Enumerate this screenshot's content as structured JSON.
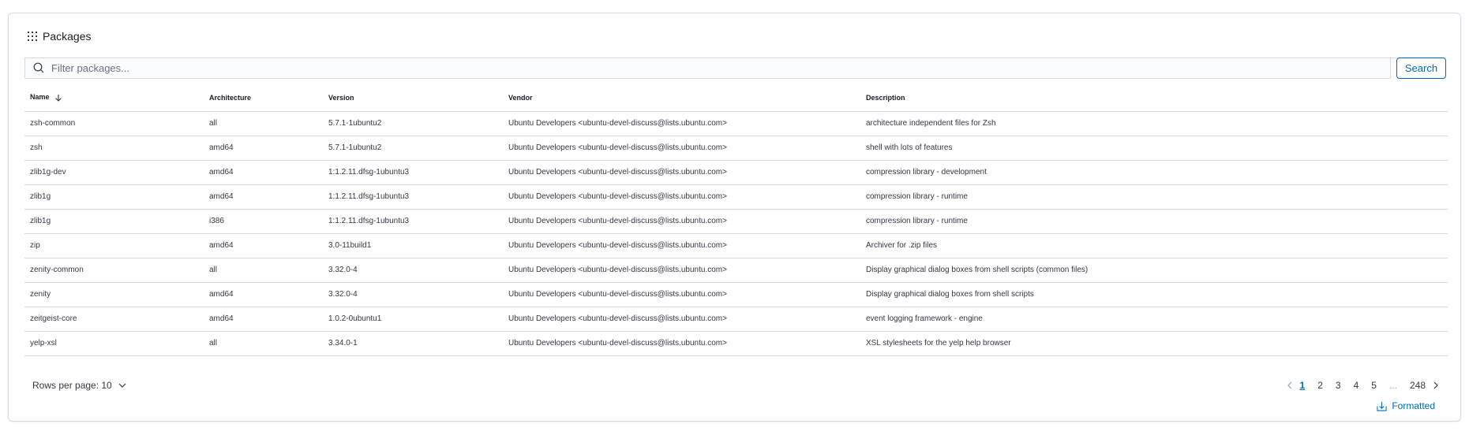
{
  "panel": {
    "title": "Packages"
  },
  "search": {
    "placeholder": "Filter packages...",
    "value": "",
    "button_label": "Search"
  },
  "table": {
    "columns": [
      "Name",
      "Architecture",
      "Version",
      "Vendor",
      "Description"
    ],
    "sorted_column": "Name",
    "sort_direction": "descending",
    "rows": [
      [
        "zsh-common",
        "all",
        "5.7.1-1ubuntu2",
        "Ubuntu Developers <ubuntu-devel-discuss@lists.ubuntu.com>",
        "architecture independent files for Zsh"
      ],
      [
        "zsh",
        "amd64",
        "5.7.1-1ubuntu2",
        "Ubuntu Developers <ubuntu-devel-discuss@lists.ubuntu.com>",
        "shell with lots of features"
      ],
      [
        "zlib1g-dev",
        "amd64",
        "1:1.2.11.dfsg-1ubuntu3",
        "Ubuntu Developers <ubuntu-devel-discuss@lists.ubuntu.com>",
        "compression library - development"
      ],
      [
        "zlib1g",
        "amd64",
        "1:1.2.11.dfsg-1ubuntu3",
        "Ubuntu Developers <ubuntu-devel-discuss@lists.ubuntu.com>",
        "compression library - runtime"
      ],
      [
        "zlib1g",
        "i386",
        "1:1.2.11.dfsg-1ubuntu3",
        "Ubuntu Developers <ubuntu-devel-discuss@lists.ubuntu.com>",
        "compression library - runtime"
      ],
      [
        "zip",
        "amd64",
        "3.0-11build1",
        "Ubuntu Developers <ubuntu-devel-discuss@lists.ubuntu.com>",
        "Archiver for .zip files"
      ],
      [
        "zenity-common",
        "all",
        "3.32.0-4",
        "Ubuntu Developers <ubuntu-devel-discuss@lists.ubuntu.com>",
        "Display graphical dialog boxes from shell scripts (common files)"
      ],
      [
        "zenity",
        "amd64",
        "3.32.0-4",
        "Ubuntu Developers <ubuntu-devel-discuss@lists.ubuntu.com>",
        "Display graphical dialog boxes from shell scripts"
      ],
      [
        "zeitgeist-core",
        "amd64",
        "1.0.2-0ubuntu1",
        "Ubuntu Developers <ubuntu-devel-discuss@lists.ubuntu.com>",
        "event logging framework - engine"
      ],
      [
        "yelp-xsl",
        "all",
        "3.34.0-1",
        "Ubuntu Developers <ubuntu-devel-discuss@lists.ubuntu.com>",
        "XSL stylesheets for the yelp help browser"
      ]
    ]
  },
  "footer": {
    "rows_per_page_label": "Rows per page: 10",
    "pages": [
      "1",
      "2",
      "3",
      "4",
      "5"
    ],
    "current_page": "1",
    "ellipsis": "...",
    "last_page": "248",
    "export_label": "Formatted"
  },
  "icons": {
    "title": "apps-grid-icon",
    "search": "search-icon",
    "sort": "arrow-down-icon",
    "rows_per_page": "chevron-down-icon",
    "prev": "chevron-left-icon",
    "next": "chevron-right-icon",
    "export": "download-icon"
  },
  "colors": {
    "accent": "#006bb8",
    "border": "#d3dae6",
    "text": "#343741"
  }
}
